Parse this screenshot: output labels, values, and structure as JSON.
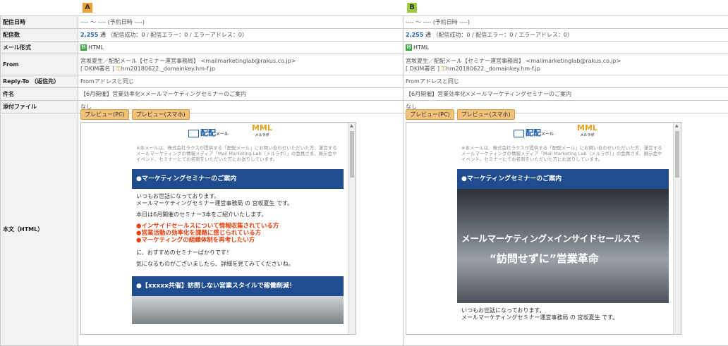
{
  "variants": {
    "a": "A",
    "b": "B"
  },
  "labels": {
    "delivery_datetime": "配信日時",
    "delivery_count": "配信数",
    "mail_format": "メール形式",
    "from": "From",
    "reply_to": "Reply-To （返信先）",
    "subject": "件名",
    "attachment": "添付ファイル",
    "body": "本文（HTML）"
  },
  "columns": [
    {
      "delivery_datetime": "---- 〜 ----  (予約日時 ----)",
      "count_number": "2,255",
      "count_unit": "通",
      "count_detail": "（配信成功：0 / 配信エラー：0 / エラーアドレス：0）",
      "format_icon": "H",
      "format": "HTML",
      "from_line1": "宮坂夏生／配配メール【セミナー運営事務局】 <mailmarketinglab@rakus.co.jp>",
      "from_line2_prefix": "[ DKIM署名 ]",
      "from_line2_value": "hm20180622._domainkey.hm-f.jp",
      "reply_to": "Fromアドレスと同じ",
      "subject": "【6月開催】営業効率化×メールマーケティングセミナーのご案内",
      "attachment": "なし"
    },
    {
      "delivery_datetime": "---- 〜 ----  (予約日時 ----)",
      "count_number": "2,255",
      "count_unit": "通",
      "count_detail": "（配信成功：0 / 配信エラー：0 / エラーアドレス：0）",
      "format_icon": "H",
      "format": "HTML",
      "from_line1": "宮坂夏生／配配メール【セミナー運営事務局】 <mailmarketinglab@rakus.co.jp>",
      "from_line2_prefix": "[ DKIM署名 ]",
      "from_line2_value": "hm20180622._domainkey.hm-f.jp",
      "reply_to": "Fromアドレスと同じ",
      "subject": "【6月開催】営業効率化×メールマーケティングセミナーのご案内",
      "attachment": "なし"
    }
  ],
  "buttons": {
    "preview_pc": "プレビュー(PC)",
    "preview_sp": "プレビュー(スマホ)"
  },
  "mail": {
    "logo1": "配配",
    "logo1_small": "メール",
    "logo2": "MML",
    "logo2_small": "メルラボ",
    "notice": "※本メールは、株式会社ラクスが提供する「配配メール」にお問い合わせいただいた方、運営するメールマーケティングの情報メディア「Mail Marketing Lab（メルラボ）」の会員さま、展示会やイベント、セミナーにてお名刺をいただいた方にお送りしています。",
    "heading": "●マーケティングセミナーのご案内",
    "greeting1": "いつもお世話になっております。",
    "greeting2": "メールマーケティングセミナー運営事務局 の 宮坂夏生 です。",
    "intro": "本日は6月開催のセミナー3本をご紹介いたします。",
    "bullet1": "●インサイドセールスについて情報収集されている方",
    "bullet2": "●営業活動の効率化を課題に感じられている方",
    "bullet3": "●マーケティングの組織体制を再考したい方",
    "rec": "に、おすすめのセミナーばかりです！",
    "closing": "気になるものがございましたら、詳細を見てみてくださいね。",
    "heading2": "●【xxxxx共催】訪問しない営業スタイルで稼働削減！",
    "banner_line1": "メールマーケティング×インサイドセールスで",
    "banner_line2": "“訪問せずに”営業革命"
  }
}
